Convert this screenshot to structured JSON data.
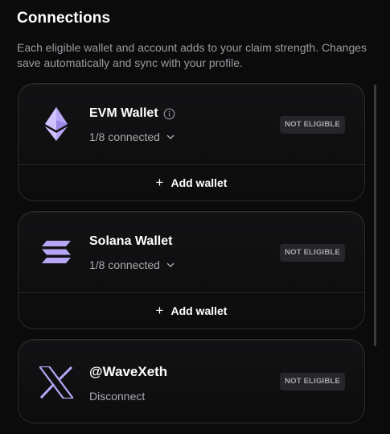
{
  "header": {
    "title": "Connections",
    "description": "Each eligible wallet and account adds to your claim strength. Changes save automatically and sync with your profile."
  },
  "colors": {
    "accent": "#b7a6f5",
    "background": "#0b0b0c",
    "badge_bg": "#26262a"
  },
  "cards": [
    {
      "name": "EVM Wallet",
      "icon": "ethereum-icon",
      "has_info_icon": true,
      "sub": "1/8 connected",
      "badge": "NOT ELIGIBLE",
      "action": "Add wallet"
    },
    {
      "name": "Solana Wallet",
      "icon": "solana-icon",
      "sub": "1/8 connected",
      "badge": "NOT ELIGIBLE",
      "action": "Add wallet"
    },
    {
      "name": "@WaveXeth",
      "icon": "x-icon",
      "sub": "Disconnect",
      "badge": "NOT ELIGIBLE"
    }
  ]
}
